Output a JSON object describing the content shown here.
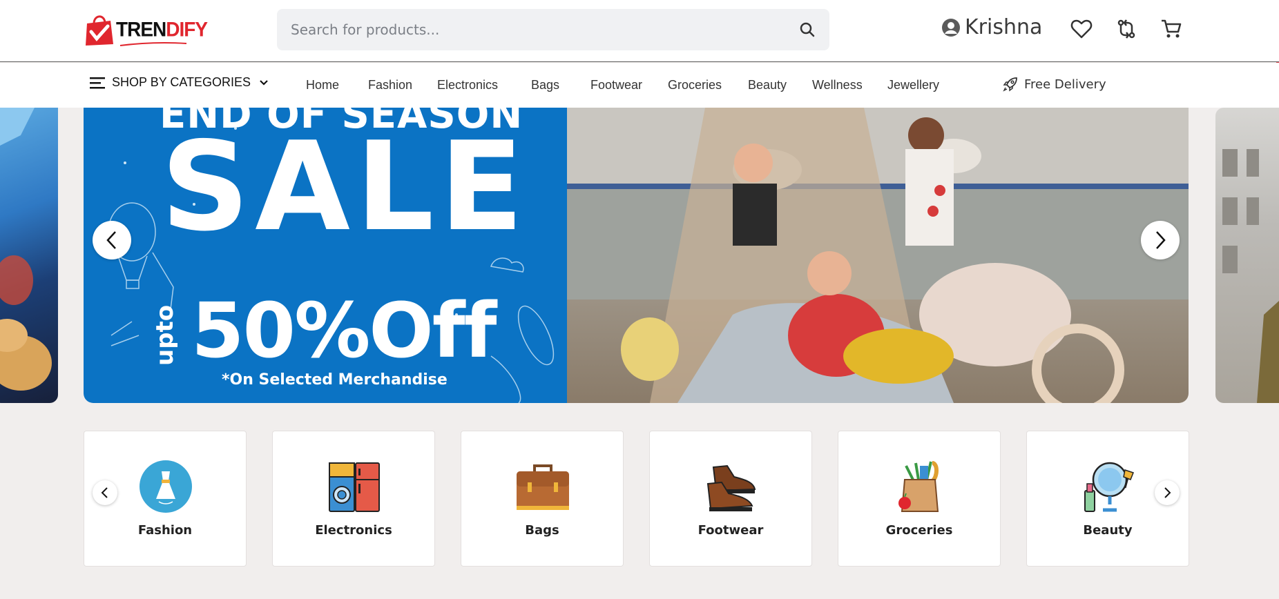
{
  "brand": {
    "name_part1": "TREN",
    "name_part2": "DIFY",
    "accent": "#e0262e"
  },
  "search": {
    "placeholder": "Search for products..."
  },
  "header": {
    "user_name": "Krishna"
  },
  "nav": {
    "categories_label": "SHOP BY CATEGORIES",
    "links": [
      "Home",
      "Fashion",
      "Electronics",
      "Bags",
      "Footwear",
      "Groceries",
      "Beauty",
      "Wellness",
      "Jewellery"
    ],
    "delivery_label": "Free Delivery"
  },
  "banner": {
    "line1": "END OF SEASON",
    "line2": "SALE",
    "upto": "upto",
    "discount": "50%Off",
    "note": "*On Selected Merchandise",
    "panel_color": "#0b73c4"
  },
  "categories": [
    {
      "label": "Fashion",
      "icon": "dress-icon"
    },
    {
      "label": "Electronics",
      "icon": "appliances-icon"
    },
    {
      "label": "Bags",
      "icon": "briefcase-icon"
    },
    {
      "label": "Footwear",
      "icon": "shoes-icon"
    },
    {
      "label": "Groceries",
      "icon": "grocery-bag-icon"
    },
    {
      "label": "Beauty",
      "icon": "cosmetics-icon"
    }
  ]
}
